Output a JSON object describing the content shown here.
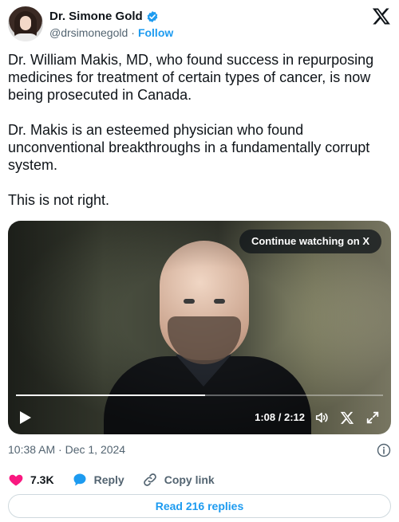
{
  "author": {
    "display_name": "Dr. Simone Gold",
    "handle": "@drsimonegold",
    "separator": "·",
    "follow_label": "Follow"
  },
  "tweet": {
    "text": "Dr. William Makis, MD, who found success in repurposing medicines for treatment of certain types of cancer, is now being prosecuted in Canada.\n\nDr. Makis is an esteemed physician who found unconventional breakthroughs in a fundamentally corrupt system.\n\nThis is not right."
  },
  "video": {
    "continue_label": "Continue watching on X",
    "time": "1:08 / 2:12",
    "progress": 0.515
  },
  "meta": {
    "timestamp": "10:38 AM · Dec 1, 2024"
  },
  "actions": {
    "likes": "7.3K",
    "reply_label": "Reply",
    "copy_link_label": "Copy link"
  },
  "footer": {
    "read_replies_label": "Read 216 replies"
  },
  "colors": {
    "accent": "#1d9bf0",
    "like": "#f91880",
    "muted": "#536471"
  }
}
